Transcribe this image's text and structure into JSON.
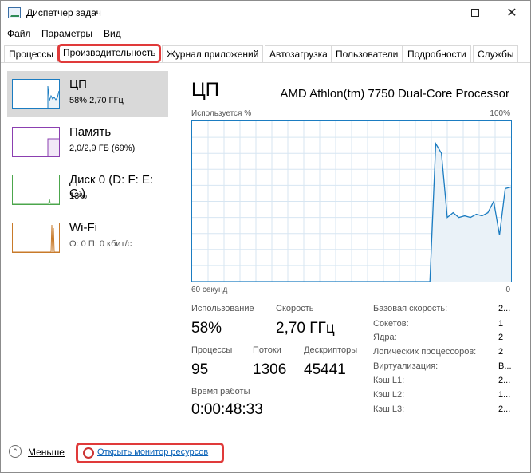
{
  "window": {
    "title": "Диспетчер задач",
    "minimize": "—",
    "close": "✕"
  },
  "menu": [
    "Файл",
    "Параметры",
    "Вид"
  ],
  "tabs": [
    {
      "label": "Процессы"
    },
    {
      "label": "Производительность"
    },
    {
      "label": "Журнал приложений"
    },
    {
      "label": "Автозагрузка"
    },
    {
      "label": "Пользователи"
    },
    {
      "label": "Подробности"
    },
    {
      "label": "Службы"
    }
  ],
  "sidebar": {
    "items": [
      {
        "title": "ЦП",
        "subtitle": "58% 2,70 ГГц",
        "color": "#1b7cc1",
        "icon": "cpu-thumbnail"
      },
      {
        "title": "Память",
        "subtitle": "2,0/2,9 ГБ (69%)",
        "color": "#8b3fb0",
        "icon": "memory-thumbnail"
      },
      {
        "title": "Диск 0 (D: F: E: C:)",
        "subtitle": "13%",
        "color": "#4ca64c",
        "icon": "disk-thumbnail"
      },
      {
        "title": "Wi-Fi",
        "subtitle": "О: 0 П: 0 кбит/с",
        "color": "#c87a2a",
        "icon": "wifi-thumbnail"
      }
    ]
  },
  "main": {
    "title": "ЦП",
    "processor": "AMD Athlon(tm) 7750 Dual-Core Processor",
    "graph": {
      "y_label": "Используется %",
      "y_max": "100%",
      "x_left": "60 секунд",
      "x_right": "0",
      "line_color": "#1b7cc1",
      "fill_color": "#eaf2f8",
      "grid_color": "#d7e6f2",
      "series": [
        0,
        0,
        0,
        0,
        0,
        0,
        0,
        0,
        0,
        0,
        0,
        0,
        0,
        0,
        0,
        0,
        0,
        0,
        0,
        0,
        0,
        0,
        0,
        0,
        0,
        0,
        0,
        0,
        0,
        0,
        0,
        0,
        0,
        0,
        0,
        0,
        0,
        0,
        0,
        0,
        0,
        0,
        86,
        80,
        40,
        43,
        40,
        41,
        40,
        42,
        41,
        43,
        50,
        29,
        58,
        59
      ]
    },
    "stats": {
      "usage_label": "Использование",
      "usage_value": "58%",
      "speed_label": "Скорость",
      "speed_value": "2,70 ГГц",
      "processes_label": "Процессы",
      "processes_value": "95",
      "threads_label": "Потоки",
      "threads_value": "1306",
      "handles_label": "Дескрипторы",
      "handles_value": "45441",
      "uptime_label": "Время работы",
      "uptime_value": "0:00:48:33"
    },
    "info": [
      {
        "label": "Базовая скорость:",
        "value": "2..."
      },
      {
        "label": "Сокетов:",
        "value": "1"
      },
      {
        "label": "Ядра:",
        "value": "2"
      },
      {
        "label": "Логических процессоров:",
        "value": "2"
      },
      {
        "label": "Виртуализация:",
        "value": "В..."
      },
      {
        "label": "Кэш L1:",
        "value": "2..."
      },
      {
        "label": "Кэш L2:",
        "value": "1..."
      },
      {
        "label": "Кэш L3:",
        "value": "2..."
      }
    ]
  },
  "footer": {
    "less_label": "Меньше",
    "monitor_label": "Открыть монитор ресурсов"
  }
}
